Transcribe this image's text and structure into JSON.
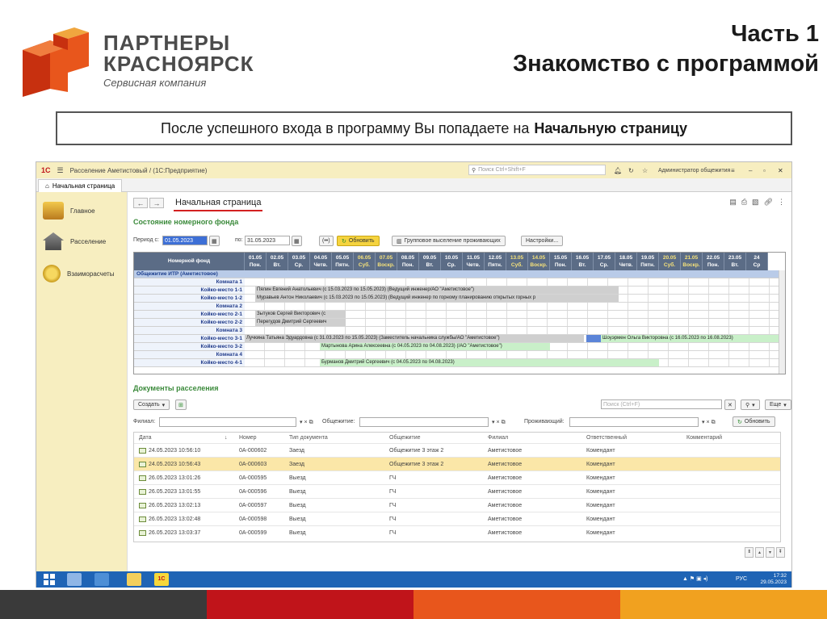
{
  "slide": {
    "brand_line1": "ПАРТНЕРЫ",
    "brand_line2": "КРАСНОЯРСК",
    "brand_line3": "Сервисная компания",
    "part_title": "Часть 1",
    "part_subtitle": "Знакомство с программой",
    "notice_text": "После успешного входа в программу Вы попадаете на",
    "notice_bold": "Начальную страницу"
  },
  "app": {
    "window_title": "Расселение Аметистовый / (1С:Предприятие)",
    "search_placeholder": "Поиск Ctrl+Shift+F",
    "user_name": "Администратор общежития",
    "tab_label": "Начальная страница",
    "sidebar": [
      {
        "label": "Главное"
      },
      {
        "label": "Расселение"
      },
      {
        "label": "Взаиморасчеты"
      }
    ],
    "page_title": "Начальная страница",
    "section_fund": "Состояние номерного фонда",
    "period_label": "Период с:",
    "period_from": "01.05.2023",
    "period_to_label": "по:",
    "period_to": "31.05.2023",
    "refresh_btn": "Обновить",
    "group_btn": "Групповое выселение проживающих",
    "settings_btn": "Настройки...",
    "grid_header": "Номерной фонд",
    "dates": [
      {
        "d": "01.05",
        "w": "Пон.",
        "we": false
      },
      {
        "d": "02.05",
        "w": "Вт.",
        "we": false
      },
      {
        "d": "03.05",
        "w": "Ср.",
        "we": false
      },
      {
        "d": "04.05",
        "w": "Четв.",
        "we": false
      },
      {
        "d": "05.05",
        "w": "Пятн.",
        "we": false
      },
      {
        "d": "06.05",
        "w": "Суб.",
        "we": true
      },
      {
        "d": "07.05",
        "w": "Воскр.",
        "we": true
      },
      {
        "d": "08.05",
        "w": "Пон.",
        "we": false
      },
      {
        "d": "09.05",
        "w": "Вт.",
        "we": false
      },
      {
        "d": "10.05",
        "w": "Ср.",
        "we": false
      },
      {
        "d": "11.05",
        "w": "Четв.",
        "we": false
      },
      {
        "d": "12.05",
        "w": "Пятн.",
        "we": false
      },
      {
        "d": "13.05",
        "w": "Суб.",
        "we": true
      },
      {
        "d": "14.05",
        "w": "Воскр.",
        "we": true
      },
      {
        "d": "15.05",
        "w": "Пон.",
        "we": false
      },
      {
        "d": "16.05",
        "w": "Вт.",
        "we": false
      },
      {
        "d": "17.05",
        "w": "Ср.",
        "we": false
      },
      {
        "d": "18.05",
        "w": "Четв.",
        "we": false
      },
      {
        "d": "19.05",
        "w": "Пятн.",
        "we": false
      },
      {
        "d": "20.05",
        "w": "Суб.",
        "we": true
      },
      {
        "d": "21.05",
        "w": "Воскр.",
        "we": true
      },
      {
        "d": "22.05",
        "w": "Пон.",
        "we": false
      },
      {
        "d": "23.05",
        "w": "Вт.",
        "we": false
      },
      {
        "d": "24",
        "w": "Ср",
        "we": false
      }
    ],
    "rooms": [
      {
        "label": "Общежитие ИТР (Аметистовое)",
        "group": true,
        "bar": "",
        "bar_type": ""
      },
      {
        "label": "Комната 1",
        "group": false,
        "bar": "",
        "bar_type": ""
      },
      {
        "label": "Койко-место 1-1",
        "group": false,
        "bar": "Пялин Евгений Анатольевич (с 15.03.2023 по 15.05.2023) (Ведущий инженер/АО \"Аметистовое\")",
        "bar_type": "g"
      },
      {
        "label": "Койко-место 1-2",
        "group": false,
        "bar": "Муравьев Антон Николаевич (с 15.03.2023 по 15.05.2023) (Ведущий инженер по горному планированию открытых горных р",
        "bar_type": "g"
      },
      {
        "label": "Комната 2",
        "group": false,
        "bar": "",
        "bar_type": ""
      },
      {
        "label": "Койко-место 2-1",
        "group": false,
        "bar": "Зытуков Сергей Викторович (с",
        "bar_type": "g"
      },
      {
        "label": "Койко-место 2-2",
        "group": false,
        "bar": "Перегудов Дмитрий Сергеевич",
        "bar_type": "g"
      },
      {
        "label": "Комната 3",
        "group": false,
        "bar": "",
        "bar_type": ""
      },
      {
        "label": "Койко-место 3-1",
        "group": false,
        "bar": "Лучкина Татьяна Эдуардовна (с 31.03.2023 по 15.05.2023) (Заместитель начальника службы/АО \"Аметистовое\")",
        "bar_type": "g"
      },
      {
        "label": "Койко-место 3-2",
        "group": false,
        "bar": "Мартынова Арина Алексеевна (с 04.05.2023 по 04.08.2023) (/АО \"Аметистовое\")",
        "bar_type": "gr"
      },
      {
        "label": "Комната 4",
        "group": false,
        "bar": "",
        "bar_type": ""
      },
      {
        "label": "Койко-место 4-1",
        "group": false,
        "bar": "Бурманов Дмитрий Сергеевич (с 04.05.2023 по 04.08.2023)",
        "bar_type": "gr"
      }
    ],
    "extra_bar": "Шоуэрмен Ольга Викторовна (с 16.05.2023 по 16.08.2023)",
    "section_docs": "Документы расселения",
    "create_btn": "Создать",
    "search_docs_placeholder": "Поиск (Ctrl+F)",
    "more_btn": "Еще",
    "filter_branch": "Филиал:",
    "filter_dorm": "Общежитие:",
    "filter_resident": "Проживающий:",
    "refresh2_btn": "Обновить",
    "columns": [
      "Дата",
      "Номер",
      "Тип документа",
      "Общежитие",
      "Филиал",
      "Ответственный",
      "Комментарий"
    ],
    "rows": [
      {
        "date": "24.05.2023 10:56:10",
        "num": "0А-000602",
        "type": "Заезд",
        "dorm": "Общежитие 3 этаж 2",
        "branch": "Аметистовое",
        "resp": "Комендант",
        "sel": false
      },
      {
        "date": "24.05.2023 10:56:43",
        "num": "0А-000603",
        "type": "Заезд",
        "dorm": "Общежитие 3 этаж 2",
        "branch": "Аметистовое",
        "resp": "Комендант",
        "sel": true
      },
      {
        "date": "26.05.2023 13:01:26",
        "num": "0А-000595",
        "type": "Выезд",
        "dorm": "ГЧ",
        "branch": "Аметистовое",
        "resp": "Комендант",
        "sel": false
      },
      {
        "date": "26.05.2023 13:01:55",
        "num": "0А-000596",
        "type": "Выезд",
        "dorm": "ГЧ",
        "branch": "Аметистовое",
        "resp": "Комендант",
        "sel": false
      },
      {
        "date": "26.05.2023 13:02:13",
        "num": "0А-000597",
        "type": "Выезд",
        "dorm": "ГЧ",
        "branch": "Аметистовое",
        "resp": "Комендант",
        "sel": false
      },
      {
        "date": "26.05.2023 13:02:48",
        "num": "0А-000598",
        "type": "Выезд",
        "dorm": "ГЧ",
        "branch": "Аметистовое",
        "resp": "Комендант",
        "sel": false
      },
      {
        "date": "26.05.2023 13:03:37",
        "num": "0А-000599",
        "type": "Выезд",
        "dorm": "ГЧ",
        "branch": "Аметистовое",
        "resp": "Комендант",
        "sel": false
      }
    ],
    "tray_lang": "РУС",
    "tray_time": "17:32",
    "tray_date": "29.05.2023"
  },
  "colors": {
    "accent_yellow": "#f5d33f",
    "grid_header": "#5b6c86",
    "stripe_dark": "#3a3a3a",
    "stripe_red": "#c0141a",
    "stripe_orange": "#f1a11f",
    "logo_orange": "#e8561c"
  }
}
